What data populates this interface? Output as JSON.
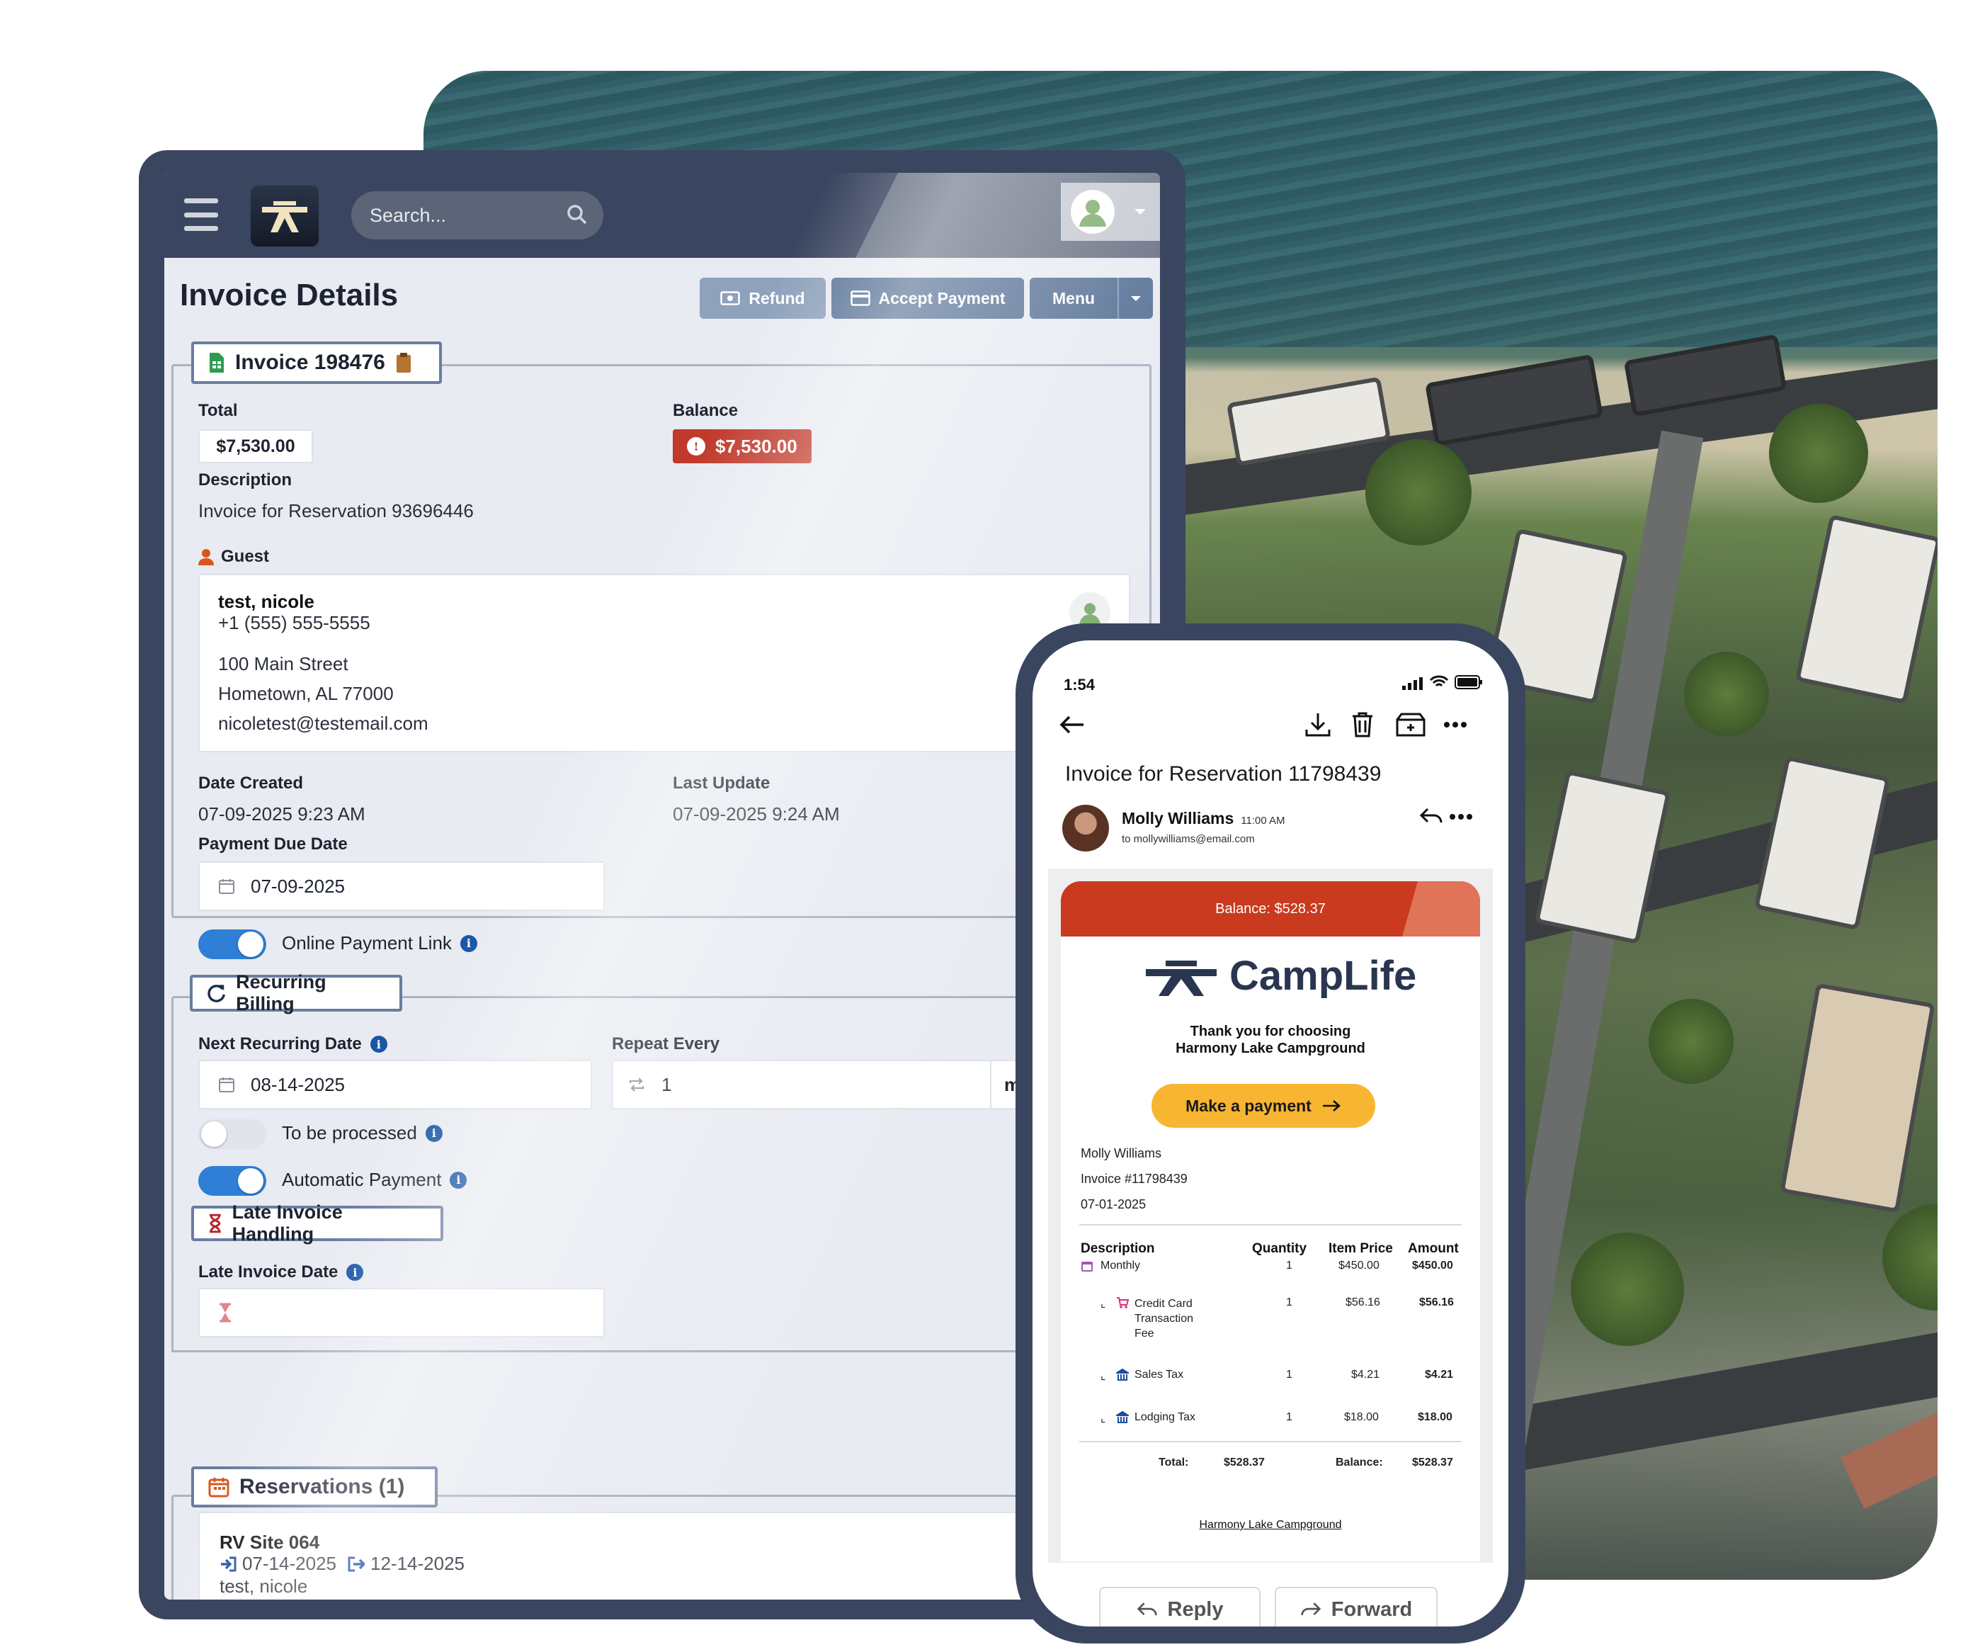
{
  "app": {
    "search_placeholder": "Search...",
    "page_title": "Invoice Details",
    "buttons": {
      "refund": "Refund",
      "accept_payment": "Accept Payment",
      "menu": "Menu"
    }
  },
  "invoice": {
    "legend": "Invoice 198476",
    "total_label": "Total",
    "total_value": "$7,530.00",
    "balance_label": "Balance",
    "balance_value": "$7,530.00",
    "description_label": "Description",
    "description_value": "Invoice for Reservation 93696446",
    "guest_label": "Guest",
    "guest": {
      "name": "test, nicole",
      "phone": "+1 (555) 555-5555",
      "street": "100 Main Street",
      "city": "Hometown, AL 77000",
      "email": "nicoletest@testemail.com"
    },
    "date_created_label": "Date Created",
    "date_created_value": "07-09-2025 9:23 AM",
    "last_update_label": "Last Update",
    "last_update_value": "07-09-2025 9:24 AM",
    "payment_due_label": "Payment Due Date",
    "payment_due_value": "07-09-2025",
    "online_payment_label": "Online Payment Link"
  },
  "recurring": {
    "legend": "Recurring Billing",
    "next_date_label": "Next Recurring Date",
    "next_date_value": "08-14-2025",
    "repeat_label": "Repeat Every",
    "repeat_value": "1",
    "repeat_unit_fragment": "m",
    "to_be_processed_label": "To be processed",
    "automatic_payment_label": "Automatic Payment"
  },
  "late": {
    "legend": "Late Invoice Handling",
    "date_label": "Late Invoice Date"
  },
  "reservations": {
    "legend": "Reservations (1)",
    "site": "RV Site 064",
    "arrive": "07-14-2025",
    "depart": "12-14-2025",
    "guest": "test, nicole"
  },
  "phone": {
    "time": "1:54",
    "subject": "Invoice for Reservation 11798439",
    "sender_name": "Molly Williams",
    "sender_time": "11:00 AM",
    "to_line": "to mollywilliams@email.com",
    "email": {
      "balance_banner": "Balance: $528.37",
      "brand": "CampLife",
      "thanks_line1": "Thank you for choosing",
      "thanks_line2": "Harmony Lake Campground",
      "pay_button": "Make a payment",
      "customer": "Molly Williams",
      "invoice_no": "Invoice #11798439",
      "date": "07-01-2025",
      "columns": [
        "Description",
        "Quantity",
        "Item Price",
        "Amount"
      ],
      "rows": [
        {
          "desc": "Monthly",
          "qty": "1",
          "price": "$450.00",
          "amount": "$450.00"
        },
        {
          "desc_l1": "Credit Card",
          "desc_l2": "Transaction",
          "desc_l3": "Fee",
          "qty": "1",
          "price": "$56.16",
          "amount": "$56.16"
        },
        {
          "desc": "Sales Tax",
          "qty": "1",
          "price": "$4.21",
          "amount": "$4.21"
        },
        {
          "desc": "Lodging Tax",
          "qty": "1",
          "price": "$18.00",
          "amount": "$18.00"
        }
      ],
      "total_label": "Total:",
      "total_value": "$528.37",
      "balance_label": "Balance:",
      "balance_value": "$528.37",
      "footer_link": "Harmony Lake Campground"
    },
    "reply": "Reply",
    "forward": "Forward"
  },
  "colors": {
    "navy": "#3a4660",
    "accent_blue": "#2f7fd6",
    "danger": "#c0392b",
    "brand_orange": "#c93a1e",
    "pay_yellow": "#f8b531"
  }
}
